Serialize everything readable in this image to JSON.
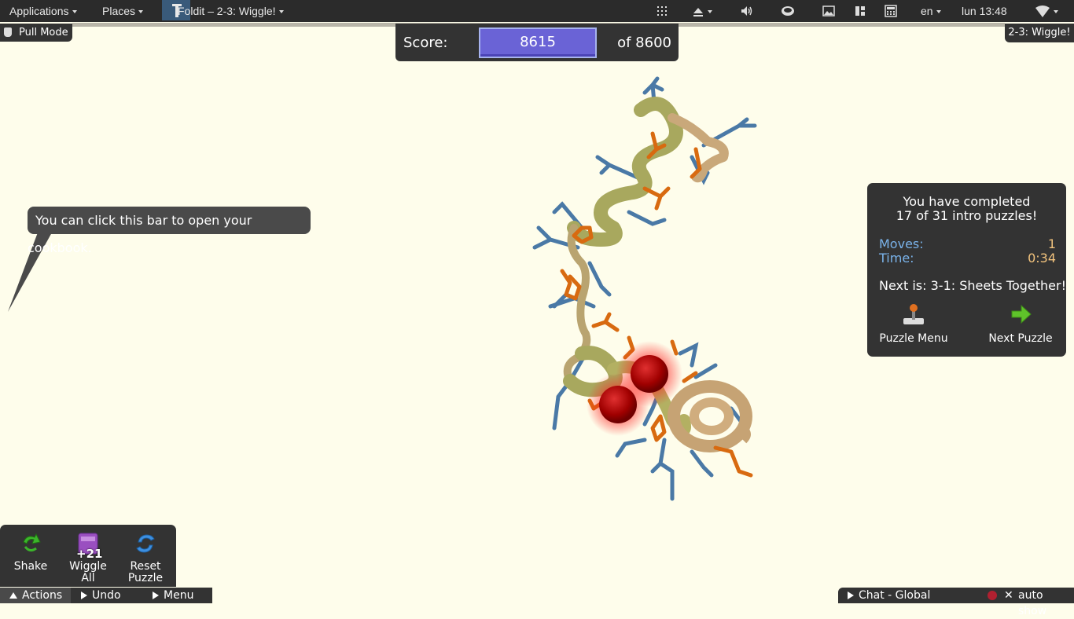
{
  "topbar": {
    "applications": "Applications",
    "places": "Places",
    "window_title": "Foldit – 2-3: Wiggle!",
    "language": "en",
    "clock": "lun 13:48",
    "icons": [
      "grid-icon",
      "eject-icon",
      "volume-icon",
      "cup-icon",
      "image-icon",
      "workspace-icon",
      "calculator-icon",
      "wifi-icon"
    ]
  },
  "hud": {
    "pull_mode": "Pull Mode",
    "puzzle_name": "2-3: Wiggle!",
    "score_label": "Score:",
    "score_value": "8615",
    "score_target": "of 8600"
  },
  "tooltip": {
    "text": "You can click this bar to open your cookbook."
  },
  "complete_panel": {
    "completed_line1": "You have completed",
    "completed_line2": "17 of 31 intro puzzles!",
    "moves_label": "Moves:",
    "moves_value": "1",
    "time_label": "Time:",
    "time_value": "0:34",
    "next_text": "Next is: 3-1: Sheets Together!",
    "puzzle_menu_label": "Puzzle Menu",
    "next_puzzle_label": "Next Puzzle"
  },
  "actions": {
    "shake_label": "Shake",
    "wiggle_label": "Wiggle",
    "wiggle_label2": "All",
    "wiggle_badge": "+21",
    "reset_label": "Reset",
    "reset_label2": "Puzzle"
  },
  "bottombar": {
    "actions_tab": "Actions",
    "undo_tab": "Undo",
    "menu_tab": "Menu",
    "chat_tab": "Chat - Global",
    "auto_show": "auto show"
  },
  "colors": {
    "background": "#fefdeb",
    "hud_dark": "#333333",
    "score_fill": "#6a63d6",
    "label_blue": "#7ab3ea",
    "value_orange": "#f2c37d",
    "backbone": "#b5b56b",
    "sidechain_blue": "#4a79a6",
    "sidechain_orange": "#d86a10",
    "clash_red": "#c01010"
  }
}
